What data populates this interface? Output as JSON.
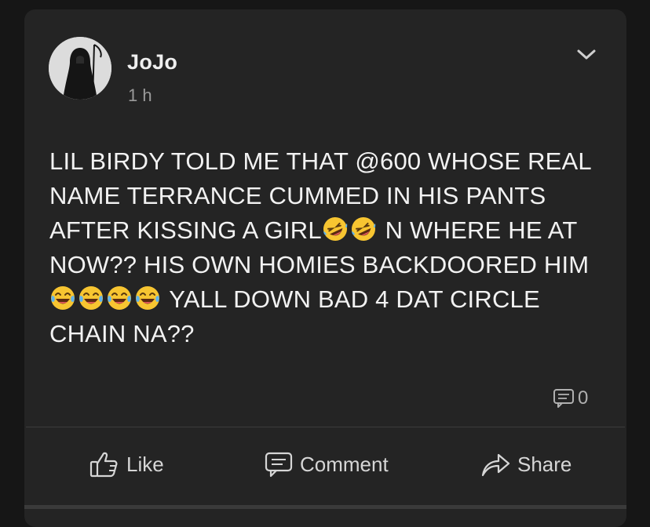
{
  "post": {
    "author": "JoJo",
    "time": "1 h",
    "text_segments": [
      {
        "type": "text",
        "value": "LIL BIRDY TOLD ME THAT @600 WHOSE REAL NAME TERRANCE CUMMED IN HIS PANTS AFTER KISSING A GIRL"
      },
      {
        "type": "emoji",
        "name": "rofl-emoji"
      },
      {
        "type": "emoji",
        "name": "rofl-emoji"
      },
      {
        "type": "text",
        "value": " N WHERE HE AT NOW?? HIS OWN HOMIES BACKDOORED HIM"
      },
      {
        "type": "emoji",
        "name": "tears-of-joy-emoji"
      },
      {
        "type": "emoji",
        "name": "tears-of-joy-emoji"
      },
      {
        "type": "emoji",
        "name": "tears-of-joy-emoji"
      },
      {
        "type": "emoji",
        "name": "tears-of-joy-emoji"
      },
      {
        "type": "text",
        "value": " YALL DOWN BAD 4 DAT CIRCLE CHAIN NA??"
      }
    ],
    "comment_count": "0"
  },
  "actions": {
    "like_label": "Like",
    "comment_label": "Comment",
    "share_label": "Share"
  },
  "icons": {
    "avatar": "grim-reaper-avatar",
    "menu": "chevron-down-icon",
    "comment_count": "comment-icon",
    "like": "thumbs-up-icon",
    "comment": "comment-icon",
    "share": "share-arrow-icon"
  },
  "colors": {
    "background": "#161616",
    "card": "#242424",
    "text": "#f2f2f2",
    "muted": "#9a9a9a"
  }
}
